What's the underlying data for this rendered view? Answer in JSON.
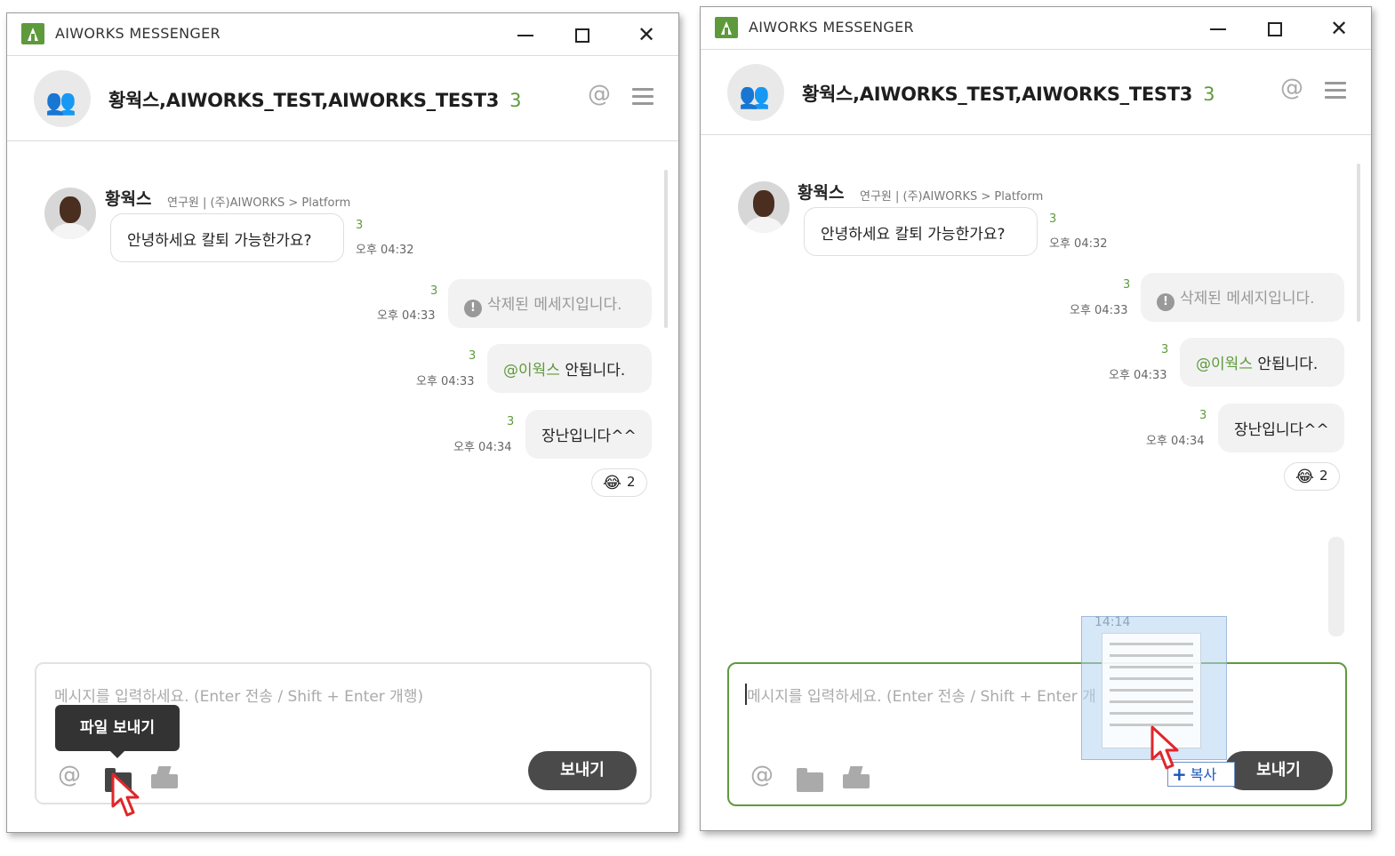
{
  "app": {
    "title": "AIWORKS MESSENGER"
  },
  "room": {
    "title": "황웍스,AIWORKS_TEST,AIWORKS_TEST3",
    "member_count": "3"
  },
  "sender": {
    "name": "황웍스",
    "meta": "연구원 | (주)AIWORKS > Platform"
  },
  "messages": [
    {
      "text": "안녕하세요 칼퇴 가능한가요?",
      "unread": "3",
      "time": "오후 04:32"
    },
    {
      "text": "삭제된 메세지입니다.",
      "unread": "3",
      "time": "오후 04:33"
    },
    {
      "mention": "@이웍스",
      "text": "안됩니다.",
      "unread": "3",
      "time": "오후 04:33"
    },
    {
      "text": "장난입니다^^",
      "unread": "3",
      "time": "오후 04:34"
    }
  ],
  "reaction": {
    "emoji": "😂",
    "count": "2"
  },
  "composer": {
    "placeholder": "메시지를 입력하세요. (Enter 전송 / Shift + Enter 개행)",
    "placeholder_truncated": "메시지를 입력하세요. (Enter 전송 / Shift + Enter 개",
    "send_label": "보내기"
  },
  "tooltip": {
    "file_send": "파일 보내기"
  },
  "drag": {
    "time": "14:14",
    "copy_label": "복사"
  },
  "icons": {
    "at": "at-icon",
    "folder": "folder-icon",
    "tray": "tray-upload-icon",
    "menu": "menu-icon",
    "group": "group-icon",
    "alert": "alert-icon"
  },
  "colors": {
    "accent": "#5e9a3c",
    "send_button": "#4a4a4a",
    "tooltip": "#333333"
  }
}
